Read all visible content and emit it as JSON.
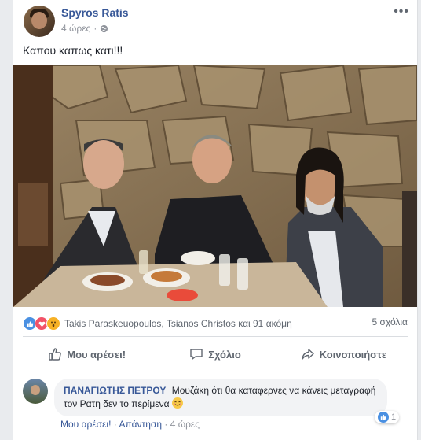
{
  "post": {
    "author": "Spyros Ratis",
    "time": "4 ώρες",
    "separator": "·",
    "text": "Καπου καπως κατι!!!"
  },
  "reactions": {
    "names": "Takis Paraskeuopoulos, Tsianos Christos και 91 ακόμη",
    "comments": "5 σχόλια",
    "icons": [
      "like-icon",
      "love-icon",
      "wow-icon"
    ]
  },
  "actions": {
    "like": "Μου αρέσει!",
    "comment": "Σχόλιο",
    "share": "Κοινοποιήστε"
  },
  "comment": {
    "author": "ΠΑΝΑΓΙΩΤΗΣ ΠΕΤΡΟΥ",
    "text": "Μουζάκη ότι θα καταφερνες να κάνεις μεταγραφή τον Ρατη δεν το περίμενα",
    "like_count": "1",
    "like_link": "Μου αρέσει!",
    "reply_link": "Απάντηση",
    "time": "4 ώρες",
    "sep": "·"
  },
  "colors": {
    "link": "#385898",
    "meta": "#90949c",
    "like": "#4a90e2",
    "love": "#f25268",
    "wow": "#f7b125"
  }
}
